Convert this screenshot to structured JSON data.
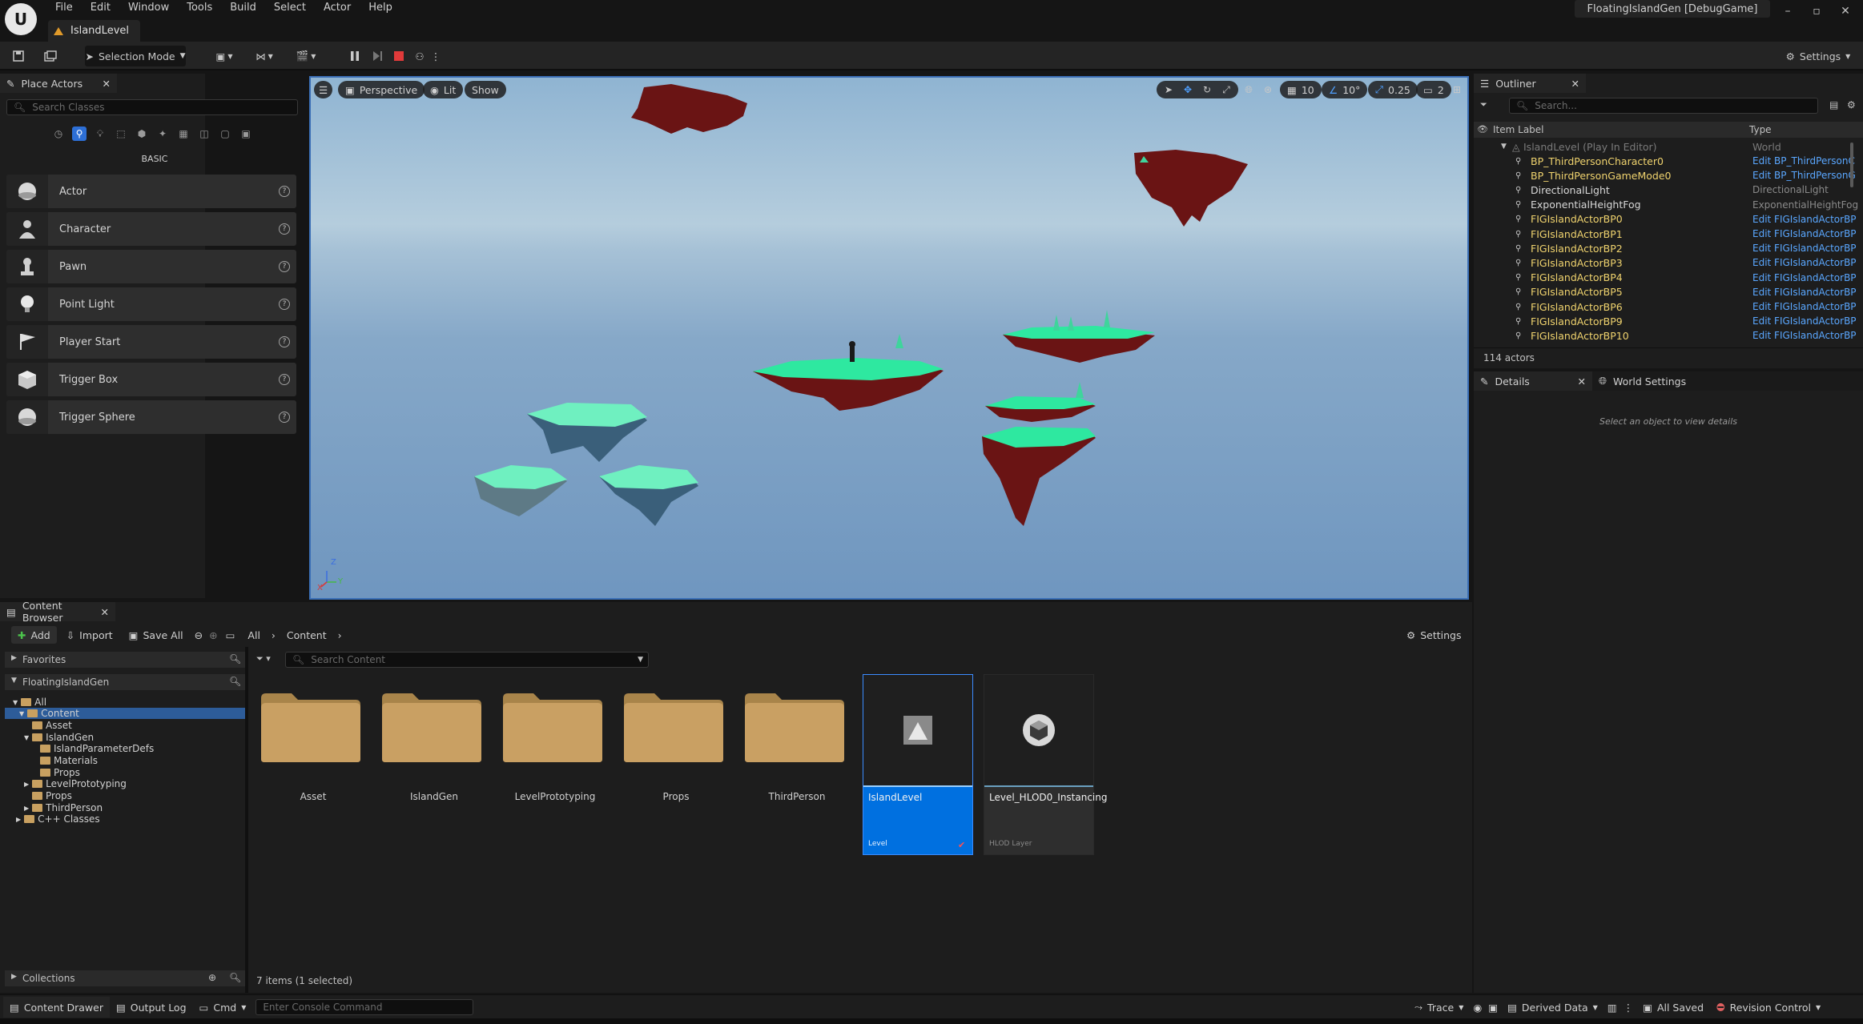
{
  "menubar": {
    "items": [
      "File",
      "Edit",
      "Window",
      "Tools",
      "Build",
      "Select",
      "Actor",
      "Help"
    ],
    "level_tab": "IslandLevel",
    "project_title": "FloatingIslandGen [DebugGame]",
    "window_controls": [
      "–",
      "▫",
      "✕"
    ]
  },
  "toolbar": {
    "selection_mode": "Selection Mode",
    "settings": "Settings"
  },
  "place_actors": {
    "tab": "Place Actors",
    "search_placeholder": "Search Classes",
    "category": "BASIC",
    "items": [
      {
        "label": "Actor",
        "icon": "sphere-icon"
      },
      {
        "label": "Character",
        "icon": "character-icon"
      },
      {
        "label": "Pawn",
        "icon": "pawn-icon"
      },
      {
        "label": "Point Light",
        "icon": "bulb-icon"
      },
      {
        "label": "Player Start",
        "icon": "flag-icon"
      },
      {
        "label": "Trigger Box",
        "icon": "box-icon"
      },
      {
        "label": "Trigger Sphere",
        "icon": "sphere-icon"
      }
    ]
  },
  "viewport": {
    "perspective": "Perspective",
    "lit": "Lit",
    "show": "Show",
    "grid_snap": "10",
    "rot_snap": "10°",
    "scale_snap": "0.25",
    "cam_speed": "2",
    "axis": {
      "x": "X",
      "y": "Y",
      "z": "Z"
    }
  },
  "outliner": {
    "tab": "Outliner",
    "search_placeholder": "Search...",
    "col_label": "Item Label",
    "col_type": "Type",
    "world_row": {
      "name": "IslandLevel (Play In Editor)",
      "type": "World"
    },
    "rows": [
      {
        "name": "BP_ThirdPersonCharacter0",
        "type": "Edit BP_ThirdPersonC",
        "link": true
      },
      {
        "name": "BP_ThirdPersonGameMode0",
        "type": "Edit BP_ThirdPersonG",
        "link": true
      },
      {
        "name": "DirectionalLight",
        "type": "DirectionalLight",
        "link": false
      },
      {
        "name": "ExponentialHeightFog",
        "type": "ExponentialHeightFog",
        "link": false
      },
      {
        "name": "FIGIslandActorBP0",
        "type": "Edit FIGIslandActorBP",
        "link": true
      },
      {
        "name": "FIGIslandActorBP1",
        "type": "Edit FIGIslandActorBP",
        "link": true
      },
      {
        "name": "FIGIslandActorBP2",
        "type": "Edit FIGIslandActorBP",
        "link": true
      },
      {
        "name": "FIGIslandActorBP3",
        "type": "Edit FIGIslandActorBP",
        "link": true
      },
      {
        "name": "FIGIslandActorBP4",
        "type": "Edit FIGIslandActorBP",
        "link": true
      },
      {
        "name": "FIGIslandActorBP5",
        "type": "Edit FIGIslandActorBP",
        "link": true
      },
      {
        "name": "FIGIslandActorBP6",
        "type": "Edit FIGIslandActorBP",
        "link": true
      },
      {
        "name": "FIGIslandActorBP9",
        "type": "Edit FIGIslandActorBP",
        "link": true
      },
      {
        "name": "FIGIslandActorBP10",
        "type": "Edit FIGIslandActorBP",
        "link": true
      }
    ],
    "count": "114 actors"
  },
  "details": {
    "tab": "Details",
    "tab2": "World Settings",
    "empty": "Select an object to view details"
  },
  "content_browser": {
    "tab": "Content Browser",
    "add": "Add",
    "import": "Import",
    "save_all": "Save All",
    "crumb_all": "All",
    "crumb_content": "Content",
    "settings": "Settings",
    "favorites": "Favorites",
    "project": "FloatingIslandGen",
    "search_placeholder": "Search Content",
    "tree": [
      "All",
      "Content",
      "Asset",
      "IslandGen",
      "IslandParameterDefs",
      "Materials",
      "Props",
      "LevelPrototyping",
      "Props",
      "ThirdPerson",
      "C++ Classes"
    ],
    "assets": [
      {
        "name": "Asset",
        "kind": "folder"
      },
      {
        "name": "IslandGen",
        "kind": "folder"
      },
      {
        "name": "LevelPrototyping",
        "kind": "folder"
      },
      {
        "name": "Props",
        "kind": "folder"
      },
      {
        "name": "ThirdPerson",
        "kind": "folder"
      },
      {
        "name": "IslandLevel",
        "kind": "level",
        "sub": "Level"
      },
      {
        "name": "Level_HLOD0_Instancing",
        "kind": "hlod",
        "sub": "HLOD Layer"
      }
    ],
    "collections": "Collections",
    "items_count": "7 items (1 selected)"
  },
  "statusbar": {
    "content_drawer": "Content Drawer",
    "output_log": "Output Log",
    "cmd": "Cmd",
    "console_placeholder": "Enter Console Command",
    "trace": "Trace",
    "derived_data": "Derived Data",
    "all_saved": "All Saved",
    "revision_control": "Revision Control"
  },
  "colors": {
    "accent": "#0070e0",
    "island_top": "#2ee8a0",
    "island_rock": "#6a1414",
    "sky_top": "#8fb4d2",
    "link": "#5aa7ff",
    "actor_name": "#f0d36e"
  }
}
